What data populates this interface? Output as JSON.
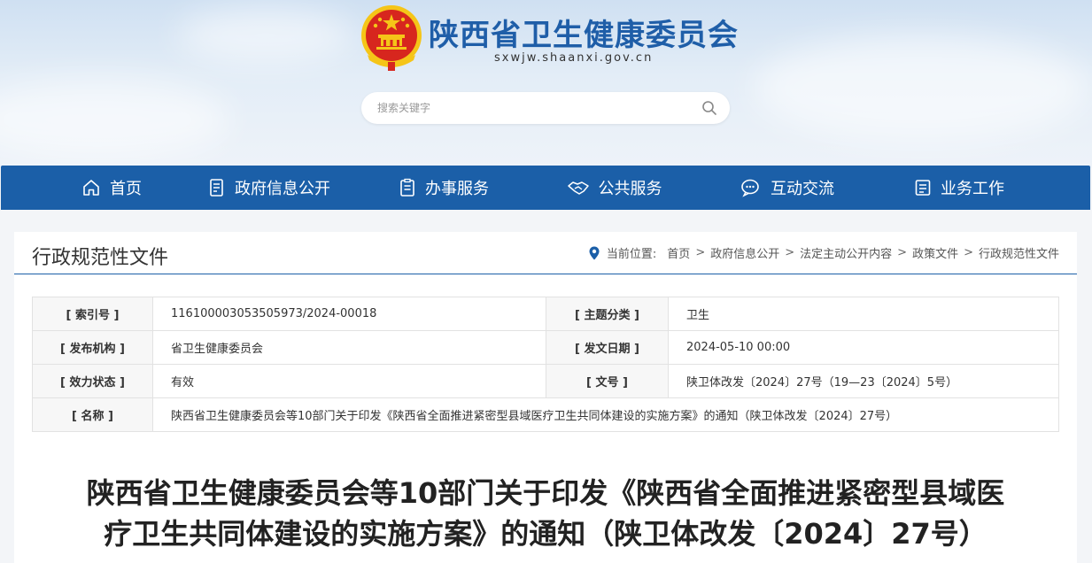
{
  "site": {
    "title": "陕西省卫生健康委员会",
    "url": "sxwjw.shaanxi.gov.cn"
  },
  "search": {
    "placeholder": "搜索关键字"
  },
  "nav": {
    "items": [
      {
        "label": "首页",
        "icon": "home-icon"
      },
      {
        "label": "政府信息公开",
        "icon": "document-list-icon"
      },
      {
        "label": "办事服务",
        "icon": "clipboard-icon"
      },
      {
        "label": "公共服务",
        "icon": "handshake-icon"
      },
      {
        "label": "互动交流",
        "icon": "chat-icon"
      },
      {
        "label": "业务工作",
        "icon": "briefcase-icon"
      }
    ]
  },
  "section": {
    "title": "行政规范性文件"
  },
  "breadcrumb": {
    "label": "当前位置:",
    "items": [
      "首页",
      "政府信息公开",
      "法定主动公开内容",
      "政策文件",
      "行政规范性文件"
    ],
    "separator": ">"
  },
  "meta": {
    "index_label": "[ 索引号 ]",
    "index_value": "116100003053505973/2024-00018",
    "topic_label": "[ 主题分类 ]",
    "topic_value": "卫生",
    "publisher_label": "[ 发布机构 ]",
    "publisher_value": "省卫生健康委员会",
    "date_label": "[ 发文日期 ]",
    "date_value": "2024-05-10 00:00",
    "status_label": "[ 效力状态 ]",
    "status_value": "有效",
    "docno_label": "[ 文号 ]",
    "docno_value": "陕卫体改发〔2024〕27号（19—23〔2024〕5号）",
    "name_label": "[ 名称 ]",
    "name_value": "陕西省卫生健康委员会等10部门关于印发《陕西省全面推进紧密型县域医疗卫生共同体建设的实施方案》的通知（陕卫体改发〔2024〕27号）"
  },
  "document": {
    "title_line1": "陕西省卫生健康委员会等10部门关于印发《陕西省全面推进紧密型县域医",
    "title_line2": "疗卫生共同体建设的实施方案》的通知（陕卫体改发〔2024〕27号）"
  },
  "colors": {
    "primary": "#1b5fa8",
    "title_blue": "#1f5ea8",
    "status_green": "#2b9a2b",
    "emblem_red": "#d7261e",
    "emblem_gold": "#f5c518"
  }
}
